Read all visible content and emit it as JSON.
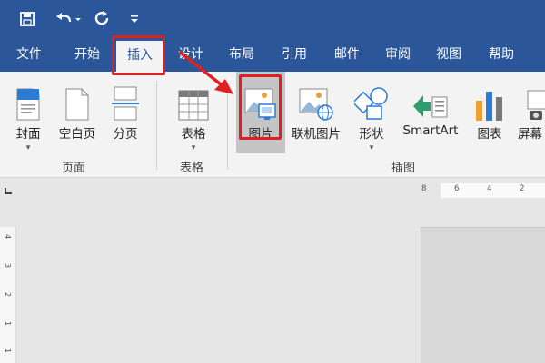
{
  "quick_access": {
    "save_icon": "save-icon",
    "undo_icon": "undo-icon",
    "redo_icon": "redo-icon",
    "customize_icon": "customize-qat-icon"
  },
  "tabs": [
    {
      "label": "文件"
    },
    {
      "label": "开始"
    },
    {
      "label": "插入"
    },
    {
      "label": "设计"
    },
    {
      "label": "布局"
    },
    {
      "label": "引用"
    },
    {
      "label": "邮件"
    },
    {
      "label": "审阅"
    },
    {
      "label": "视图"
    },
    {
      "label": "帮助"
    }
  ],
  "ribbon": {
    "pages_group": {
      "label": "页面",
      "buttons": [
        {
          "label": "封面"
        },
        {
          "label": "空白页"
        },
        {
          "label": "分页"
        }
      ]
    },
    "table_group": {
      "label": "表格",
      "buttons": [
        {
          "label": "表格"
        }
      ]
    },
    "illustrations_group": {
      "label": "插图",
      "buttons": [
        {
          "label": "图片"
        },
        {
          "label": "联机图片"
        },
        {
          "label": "形状"
        },
        {
          "label": "SmartArt"
        },
        {
          "label": "图表"
        },
        {
          "label": "屏幕"
        }
      ]
    }
  },
  "ruler": {
    "h_marks": [
      "8",
      "6",
      "4",
      "2"
    ],
    "v_marks": [
      "4",
      "3",
      "2",
      "1",
      "1"
    ]
  },
  "colors": {
    "brand_blue": "#2b579a",
    "highlight_red": "#e02020"
  }
}
